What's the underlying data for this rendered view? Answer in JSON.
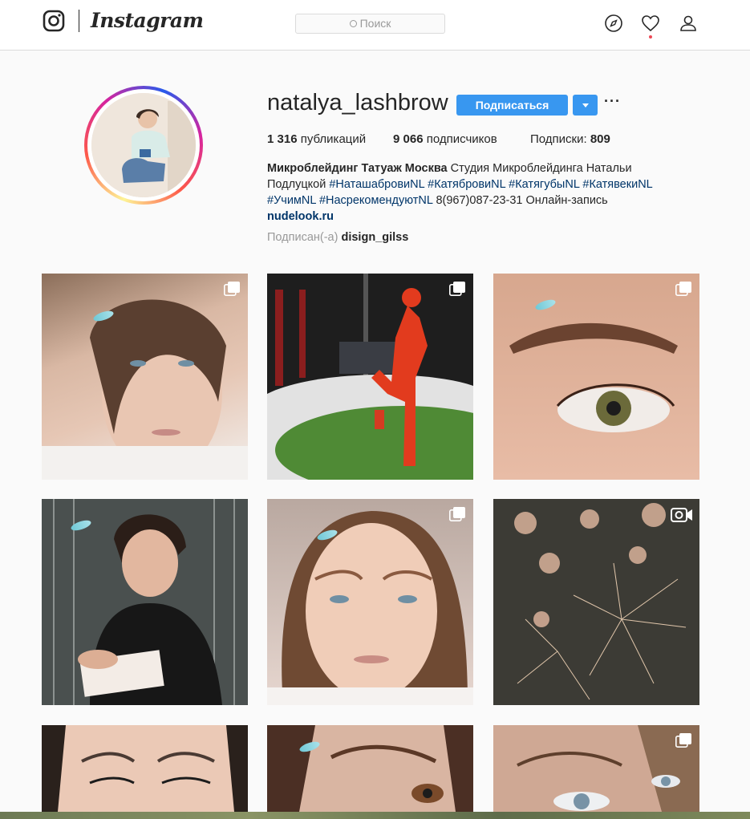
{
  "header": {
    "logo_text": "Instagram",
    "search_placeholder": "Поиск",
    "icons": [
      "instagram-logo-icon",
      "compass-icon",
      "heart-icon",
      "user-icon"
    ],
    "notification_dot_color": "#ed4956"
  },
  "profile": {
    "username": "natalya_lashbrow",
    "follow_label": "Подписаться",
    "more_label": "···",
    "stats": {
      "posts_count": "1 316",
      "posts_label": "публикаций",
      "followers_count": "9 066",
      "followers_label": "подписчиков",
      "following_label": "Подписки:",
      "following_count": "809"
    },
    "bio": {
      "name": "Микроблейдинг Татуаж Москва",
      "text1": "Студия Микроблейдинга Натальи Подлуцкой",
      "tags1": [
        "#НаташабровиNL",
        "#КатябровиNL",
        "#КатягубыNL",
        "#КатявекиNL",
        "#УчимNL",
        "#НасрекомендуютNL"
      ],
      "text2": "8(967)087-23-31 Онлайн-запись",
      "website": "nudelook.ru"
    },
    "followed_by_label": "Подписан(-а)",
    "followed_by_user": "disign_gilss"
  },
  "colors": {
    "accent": "#3897f0",
    "link": "#003569",
    "border": "#dbdbdb",
    "background": "#fafafa"
  },
  "posts": [
    {
      "type": "carousel",
      "subject": "woman-face-portrait"
    },
    {
      "type": "carousel",
      "subject": "red-mannequin-statue"
    },
    {
      "type": "carousel",
      "subject": "eyebrow-closeup"
    },
    {
      "type": "image",
      "subject": "woman-short-hair-portrait"
    },
    {
      "type": "carousel",
      "subject": "woman-selfie"
    },
    {
      "type": "video",
      "subject": "fireworks"
    },
    {
      "type": "image",
      "subject": "asian-eyes-closeup"
    },
    {
      "type": "image",
      "subject": "eye-closeup"
    },
    {
      "type": "carousel",
      "subject": "blue-eye-closeup"
    }
  ]
}
